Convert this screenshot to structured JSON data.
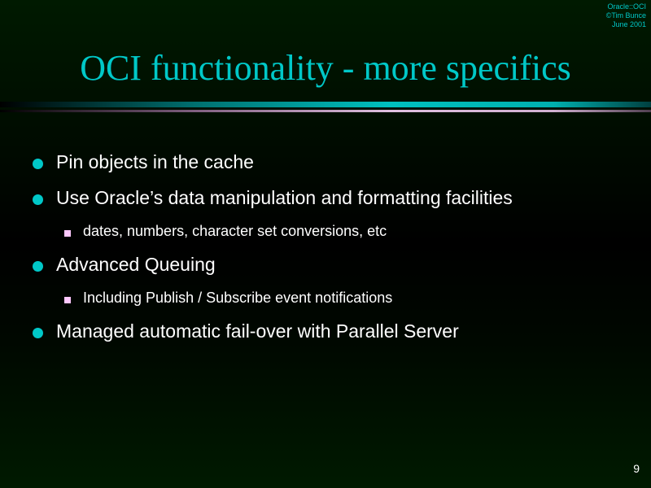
{
  "header": {
    "meta": [
      "Oracle::OCI",
      "©Tim Bunce",
      "June 2001"
    ],
    "title": "OCI functionality - more specifics"
  },
  "bullets": [
    {
      "level": 1,
      "text": "Pin objects in the cache"
    },
    {
      "level": 1,
      "text": "Use Oracle’s data manipulation and formatting facilities"
    },
    {
      "level": 2,
      "text": "dates, numbers, character set conversions, etc"
    },
    {
      "level": 1,
      "text": "Advanced Queuing"
    },
    {
      "level": 2,
      "text": "Including Publish / Subscribe event notifications"
    },
    {
      "level": 1,
      "text": "Managed automatic fail-over with Parallel Server"
    }
  ],
  "footer": {
    "page_number": "9"
  }
}
